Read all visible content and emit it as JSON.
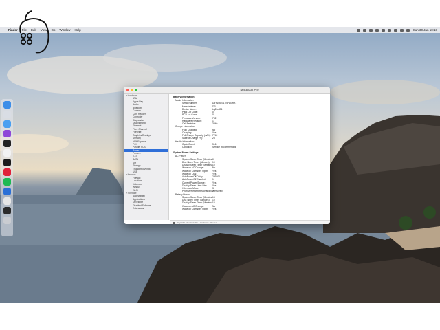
{
  "menubar": {
    "app": "Finder",
    "items": [
      "File",
      "Edit",
      "View",
      "Go",
      "Window",
      "Help"
    ],
    "clock": "Sun 30 Jan 10:18"
  },
  "window": {
    "title": "MacBook Pro",
    "path": "Crystal's MacBook Pro › Hardware › Power"
  },
  "sidebar": [
    {
      "label": "Hardware",
      "kind": "group"
    },
    {
      "label": "ATA",
      "kind": "item"
    },
    {
      "label": "Apple Pay",
      "kind": "item"
    },
    {
      "label": "Audio",
      "kind": "item"
    },
    {
      "label": "Bluetooth",
      "kind": "item"
    },
    {
      "label": "Camera",
      "kind": "item"
    },
    {
      "label": "Card Reader",
      "kind": "item"
    },
    {
      "label": "Controller",
      "kind": "item"
    },
    {
      "label": "Diagnostics",
      "kind": "item"
    },
    {
      "label": "Disc Burning",
      "kind": "item"
    },
    {
      "label": "Ethernet",
      "kind": "item"
    },
    {
      "label": "Fibre Channel",
      "kind": "item"
    },
    {
      "label": "FireWire",
      "kind": "item"
    },
    {
      "label": "Graphics/Displays",
      "kind": "item"
    },
    {
      "label": "Memory",
      "kind": "item"
    },
    {
      "label": "NVMExpress",
      "kind": "item"
    },
    {
      "label": "PCI",
      "kind": "item"
    },
    {
      "label": "Parallel SCSI",
      "kind": "item"
    },
    {
      "label": "Power",
      "kind": "item",
      "selected": true
    },
    {
      "label": "Printers",
      "kind": "item"
    },
    {
      "label": "SAS",
      "kind": "item"
    },
    {
      "label": "SATA",
      "kind": "item"
    },
    {
      "label": "SPI",
      "kind": "item"
    },
    {
      "label": "Storage",
      "kind": "item"
    },
    {
      "label": "Thunderbolt/USB4",
      "kind": "item"
    },
    {
      "label": "USB",
      "kind": "item"
    },
    {
      "label": "Network",
      "kind": "group"
    },
    {
      "label": "Firewall",
      "kind": "item"
    },
    {
      "label": "Locations",
      "kind": "item"
    },
    {
      "label": "Volumes",
      "kind": "item"
    },
    {
      "label": "WWAN",
      "kind": "item"
    },
    {
      "label": "Wi-Fi",
      "kind": "item"
    },
    {
      "label": "Software",
      "kind": "group"
    },
    {
      "label": "Accessibility",
      "kind": "item"
    },
    {
      "label": "Applications",
      "kind": "item"
    },
    {
      "label": "Developer",
      "kind": "item"
    },
    {
      "label": "Disabled Software",
      "kind": "item"
    },
    {
      "label": "Extensions",
      "kind": "item"
    }
  ],
  "content": {
    "battery_heading": "Battery Information:",
    "battery_rows": [
      {
        "k": "Model Information:",
        "v": "",
        "indent": 1
      },
      {
        "k": "Serial Number:",
        "v": "D8Y1060717NPW1RX1",
        "indent": 2
      },
      {
        "k": "Manufacturer:",
        "v": "DP",
        "indent": 2
      },
      {
        "k": "Device Name:",
        "v": "bq20z451",
        "indent": 2
      },
      {
        "k": "Pack Lot Code:",
        "v": "0",
        "indent": 2
      },
      {
        "k": "PCB Lot Code:",
        "v": "0",
        "indent": 2
      },
      {
        "k": "Firmware Version:",
        "v": "702",
        "indent": 2
      },
      {
        "k": "Hardware Revision:",
        "v": "1",
        "indent": 2
      },
      {
        "k": "Cell Revision:",
        "v": "3340",
        "indent": 2
      },
      {
        "k": "Charge Information:",
        "v": "",
        "indent": 1
      },
      {
        "k": "Fully Charged:",
        "v": "No",
        "indent": 2
      },
      {
        "k": "Charging:",
        "v": "Yes",
        "indent": 2
      },
      {
        "k": "Full Charge Capacity (mAh):",
        "v": "7742",
        "indent": 2
      },
      {
        "k": "State of Charge (%):",
        "v": "23",
        "indent": 2
      },
      {
        "k": "Health Information:",
        "v": "",
        "indent": 1
      },
      {
        "k": "Cycle Count:",
        "v": "516",
        "indent": 2
      },
      {
        "k": "Condition:",
        "v": "Service Recommended",
        "indent": 2
      }
    ],
    "power_heading": "System Power Settings:",
    "power_rows": [
      {
        "k": "AC Power:",
        "v": "",
        "indent": 1
      },
      {
        "k": "System Sleep Timer (Minutes):",
        "v": "0",
        "indent": 2
      },
      {
        "k": "Disk Sleep Timer (Minutes):",
        "v": "10",
        "indent": 2
      },
      {
        "k": "Display Sleep Timer (Minutes):",
        "v": "10",
        "indent": 2
      },
      {
        "k": "Wake on AC Change:",
        "v": "No",
        "indent": 2
      },
      {
        "k": "Wake on Clamshell Open:",
        "v": "Yes",
        "indent": 2
      },
      {
        "k": "Wake on LAN:",
        "v": "Yes",
        "indent": 2
      },
      {
        "k": "AutoPowerOff Delay:",
        "v": "259200",
        "indent": 2
      },
      {
        "k": "AutoPowerOff Enabled:",
        "v": "1",
        "indent": 2
      },
      {
        "k": "Current Power Source:",
        "v": "Yes",
        "indent": 2
      },
      {
        "k": "Display Sleep Uses Dim:",
        "v": "Yes",
        "indent": 2
      },
      {
        "k": "Hibernate Mode:",
        "v": "3",
        "indent": 2
      },
      {
        "k": "PrioritizeNetworkReachabilityOverSleep:",
        "v": "0",
        "indent": 2
      },
      {
        "k": "Battery Power:",
        "v": "",
        "indent": 1
      },
      {
        "k": "System Sleep Timer (Minutes):",
        "v": "15",
        "indent": 2
      },
      {
        "k": "Disk Sleep Timer (Minutes):",
        "v": "10",
        "indent": 2
      },
      {
        "k": "Display Sleep Timer (Minutes):",
        "v": "15",
        "indent": 2
      },
      {
        "k": "Wake on AC Change:",
        "v": "No",
        "indent": 2
      },
      {
        "k": "Wake on Clamshell Open:",
        "v": "Yes",
        "indent": 2
      }
    ]
  },
  "dock_apps": [
    {
      "name": "finder",
      "color": "#3d8ee8"
    },
    {
      "name": "launchpad",
      "color": "#d9dde4"
    },
    {
      "name": "safari",
      "color": "#4aa0f0"
    },
    {
      "name": "podcasts",
      "color": "#8e48d8"
    },
    {
      "name": "terminal",
      "color": "#222222"
    },
    {
      "name": "calendar",
      "color": "#f2f2f2"
    },
    {
      "name": "stocks",
      "color": "#1b1b1b"
    },
    {
      "name": "opera",
      "color": "#e0223a"
    },
    {
      "name": "spotify",
      "color": "#1db954"
    },
    {
      "name": "1password",
      "color": "#2a6fd6"
    },
    {
      "name": "app-store",
      "color": "#e6e6e6"
    },
    {
      "name": "activity-monitor",
      "color": "#2b2b2b"
    },
    {
      "name": "trash",
      "color": "#c9ccd1"
    }
  ]
}
